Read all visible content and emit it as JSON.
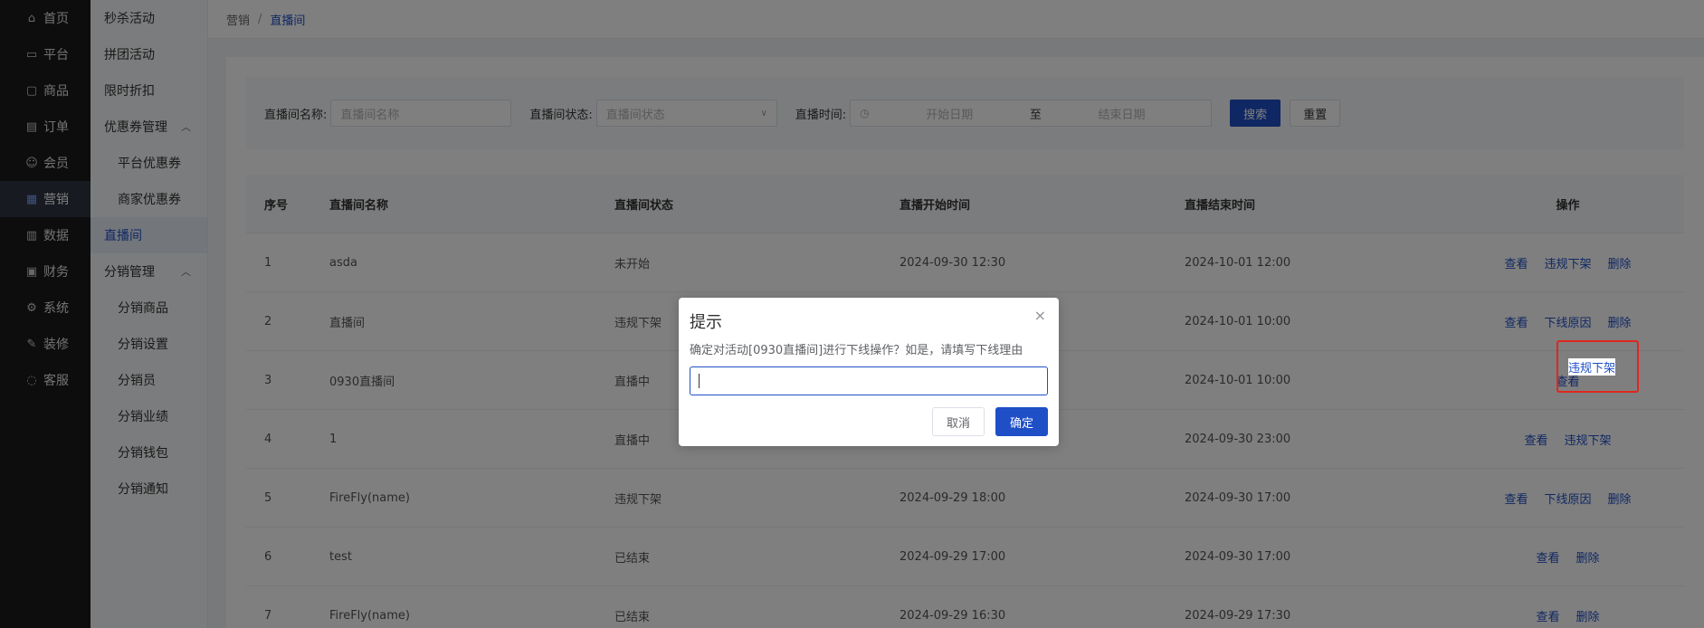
{
  "nav1": {
    "items": [
      {
        "label": "首页",
        "icon": "home-icon",
        "glyph": "⌂"
      },
      {
        "label": "平台",
        "icon": "monitor-icon",
        "glyph": "▭"
      },
      {
        "label": "商品",
        "icon": "bag-icon",
        "glyph": "▢"
      },
      {
        "label": "订单",
        "icon": "document-icon",
        "glyph": "▤"
      },
      {
        "label": "会员",
        "icon": "users-icon",
        "glyph": "☺"
      },
      {
        "label": "营销",
        "icon": "gift-icon",
        "glyph": "▦"
      },
      {
        "label": "数据",
        "icon": "chart-icon",
        "glyph": "▥"
      },
      {
        "label": "财务",
        "icon": "wallet-icon",
        "glyph": "▣"
      },
      {
        "label": "系统",
        "icon": "gear-icon",
        "glyph": "⚙"
      },
      {
        "label": "装修",
        "icon": "brush-icon",
        "glyph": "✎"
      },
      {
        "label": "客服",
        "icon": "chat-icon",
        "glyph": "◌"
      }
    ]
  },
  "nav2": {
    "items": [
      {
        "label": "秒杀活动"
      },
      {
        "label": "拼团活动"
      },
      {
        "label": "限时折扣"
      },
      {
        "label": "优惠券管理",
        "chev": "︿"
      },
      {
        "label": "平台优惠券"
      },
      {
        "label": "商家优惠券"
      },
      {
        "label": "直播间"
      },
      {
        "label": "分销管理",
        "chev": "︿"
      },
      {
        "label": "分销商品"
      },
      {
        "label": "分销设置"
      },
      {
        "label": "分销员"
      },
      {
        "label": "分销业绩"
      },
      {
        "label": "分销钱包"
      },
      {
        "label": "分销通知"
      }
    ]
  },
  "breadcrumb": {
    "level1": "营销",
    "separator": "/",
    "level2": "直播间"
  },
  "filter": {
    "name_label": "直播间名称:",
    "name_placeholder": "直播间名称",
    "status_label": "直播间状态:",
    "status_placeholder": "直播间状态",
    "time_label": "直播时间:",
    "start_placeholder": "开始日期",
    "to": "至",
    "end_placeholder": "结束日期",
    "search": "搜索",
    "reset": "重置"
  },
  "table": {
    "headers": [
      "序号",
      "直播间名称",
      "直播间状态",
      "直播开始时间",
      "直播结束时间",
      "操作"
    ],
    "rows": [
      {
        "no": "1",
        "name": "asda",
        "status": "未开始",
        "start": "2024-09-30 12:30",
        "end": "2024-10-01 12:00",
        "actions": [
          "查看",
          "违规下架",
          "删除"
        ]
      },
      {
        "no": "2",
        "name": "直播间",
        "status": "违规下架",
        "start": "",
        "end": "2024-10-01 10:00",
        "actions": [
          "查看",
          "下线原因",
          "删除"
        ]
      },
      {
        "no": "3",
        "name": "0930直播间",
        "status": "直播中",
        "start": "",
        "end": "2024-10-01 10:00",
        "actions": [
          "查看"
        ]
      },
      {
        "no": "4",
        "name": "1",
        "status": "直播中",
        "start": "",
        "end": "2024-09-30 23:00",
        "actions": [
          "查看",
          "违规下架"
        ]
      },
      {
        "no": "5",
        "name": "FireFly(name)",
        "status": "违规下架",
        "start": "2024-09-29 18:00",
        "end": "2024-09-30 17:00",
        "actions": [
          "查看",
          "下线原因",
          "删除"
        ]
      },
      {
        "no": "6",
        "name": "test",
        "status": "已结束",
        "start": "2024-09-29 17:00",
        "end": "2024-09-30 17:00",
        "actions": [
          "查看",
          "删除"
        ]
      },
      {
        "no": "7",
        "name": "FireFly(name)",
        "status": "已结束",
        "start": "2024-09-29 16:30",
        "end": "2024-09-29 17:30",
        "actions": [
          "查看",
          "删除"
        ]
      }
    ],
    "highlighted_action": "违规下架"
  },
  "dialog": {
    "title": "提示",
    "close": "×",
    "message": "确定对活动[0930直播间]进行下线操作？如是，请填写下线理由",
    "input_value": "",
    "cancel": "取消",
    "confirm": "确定"
  },
  "colors": {
    "primary": "#1f4fc7",
    "highlight_border": "#e0261f",
    "sidebar": "#1a1a1a"
  }
}
